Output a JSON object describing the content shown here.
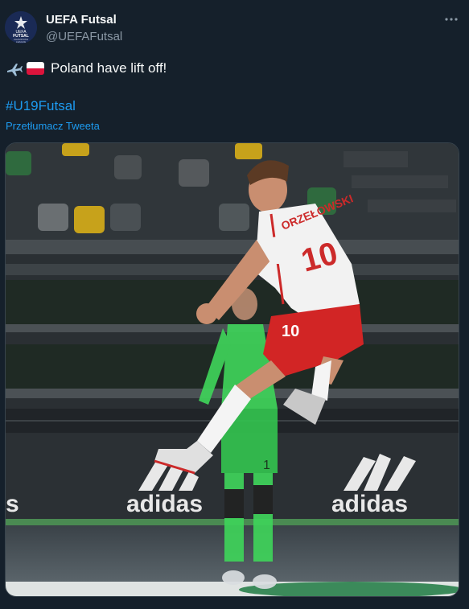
{
  "author": {
    "display_name": "UEFA Futsal",
    "handle": "@UEFAFutsal",
    "avatar_logo_text": [
      "UEFA",
      "FUTSAL",
      "CHAMPIONS",
      "LEAGUE"
    ]
  },
  "more_icon": "more-horizontal-icon",
  "tweet": {
    "emoji": [
      "airplane",
      "poland-flag"
    ],
    "text": "Poland have lift off!",
    "hashtag": "#U19Futsal",
    "translate_label": "Przetłumacz Tweeta"
  },
  "media": {
    "description_icon": "photo",
    "jersey_name": "ORZEŁOWSKI",
    "jersey_number": "10",
    "shorts_number": "10",
    "goalkeeper_number": "1",
    "sponsor_text": "adidas"
  },
  "colors": {
    "background": "#15202b",
    "text": "#f7f9f9",
    "secondary": "#8b98a5",
    "link": "#1d9bf0",
    "border": "#38444d"
  }
}
